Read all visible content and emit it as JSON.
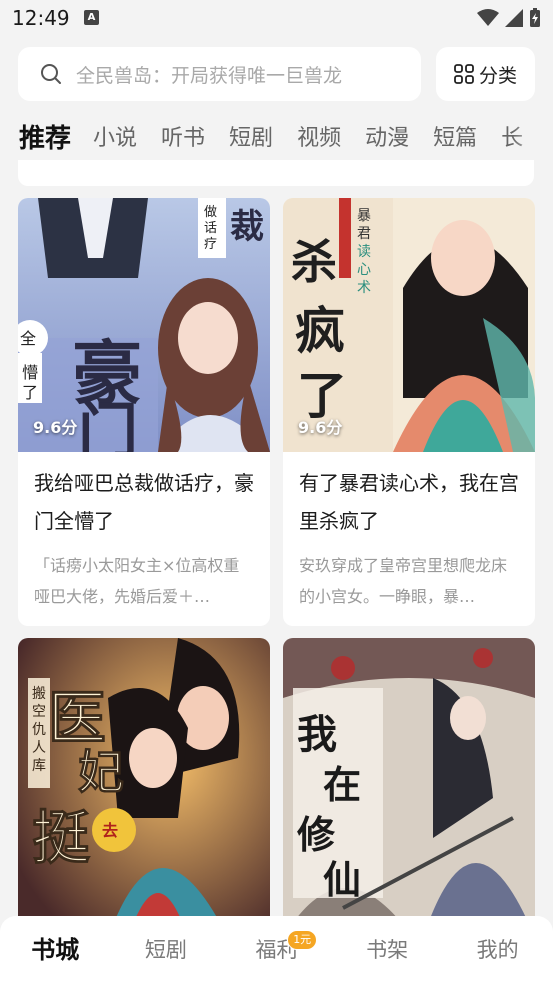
{
  "status_bar": {
    "time": "12:49",
    "notif_glyph": "A"
  },
  "search": {
    "placeholder": "全民兽岛：开局获得唯一巨兽龙",
    "category_label": "分类"
  },
  "tabs": [
    "推荐",
    "小说",
    "听书",
    "短剧",
    "视频",
    "动漫",
    "短篇",
    "长"
  ],
  "books": [
    {
      "score": "9.6分",
      "title": "我给哑巴总裁做话疗，豪门全懵了",
      "desc": "「话痨小太阳女主×位高权重哑巴大佬，先婚后爱＋…"
    },
    {
      "score": "9.6分",
      "title": "有了暴君读心术，我在宫里杀疯了",
      "desc": "安玖穿成了皇帝宫里想爬龙床的小宫女。一睁眼，暴…"
    },
    {
      "score": "",
      "title": "",
      "desc": ""
    },
    {
      "score": "",
      "title": "",
      "desc": ""
    }
  ],
  "bottom_nav": {
    "items": [
      "书城",
      "短剧",
      "福利",
      "书架",
      "我的"
    ],
    "badge": "1元"
  },
  "colors": {
    "accent_badge": "#f5a623",
    "background": "#f3f3f3"
  }
}
